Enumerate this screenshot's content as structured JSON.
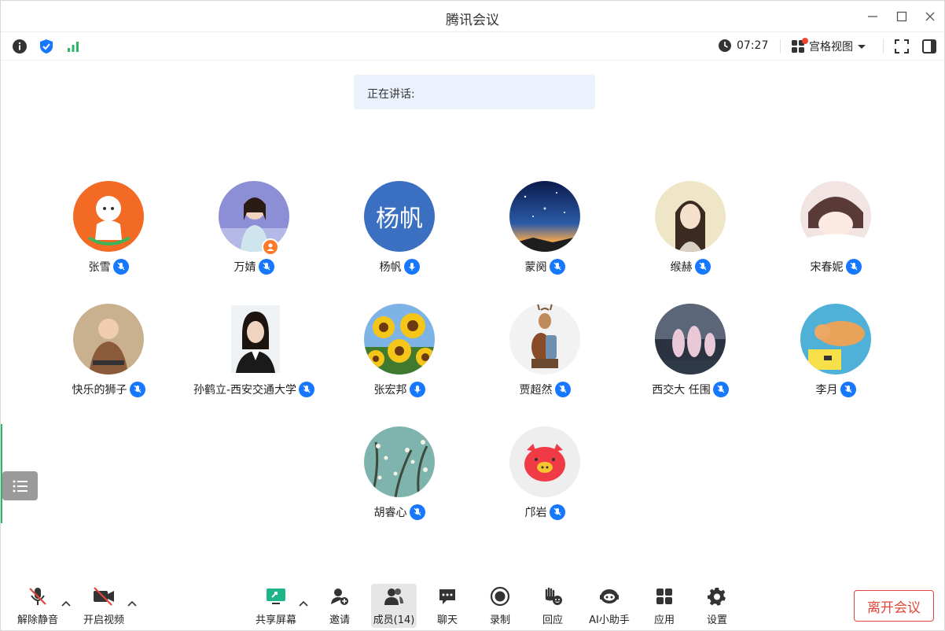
{
  "window": {
    "title": "腾讯会议"
  },
  "infobar": {
    "timer": "07:27",
    "view_label": "宫格视图"
  },
  "speaking": {
    "label": "正在讲话:"
  },
  "participants": [
    {
      "name": "张雪"
    },
    {
      "name": "万婧",
      "host": true
    },
    {
      "name": "杨帆",
      "avatar_text": "杨帆"
    },
    {
      "name": "蒙阕"
    },
    {
      "name": "缑赫"
    },
    {
      "name": "宋春妮"
    },
    {
      "name": "快乐的狮子"
    },
    {
      "name": "孙鹤立-西安交通大学"
    },
    {
      "name": "张宏邦"
    },
    {
      "name": "贾超然"
    },
    {
      "name": "西交大 任围"
    },
    {
      "name": "李月"
    },
    {
      "name": "胡睿心"
    },
    {
      "name": "邝岩"
    }
  ],
  "toolbar": {
    "unmute": "解除静音",
    "start_video": "开启视频",
    "share_screen": "共享屏幕",
    "invite": "邀请",
    "members": "成员(14)",
    "chat": "聊天",
    "record": "录制",
    "react": "回应",
    "ai_assistant": "AI小助手",
    "apps": "应用",
    "settings": "设置",
    "leave": "离开会议"
  },
  "colors": {
    "accent": "#1677ff",
    "leave": "#e0473b",
    "share_green": "#1fb58a",
    "signal_green": "#2fb56a"
  }
}
